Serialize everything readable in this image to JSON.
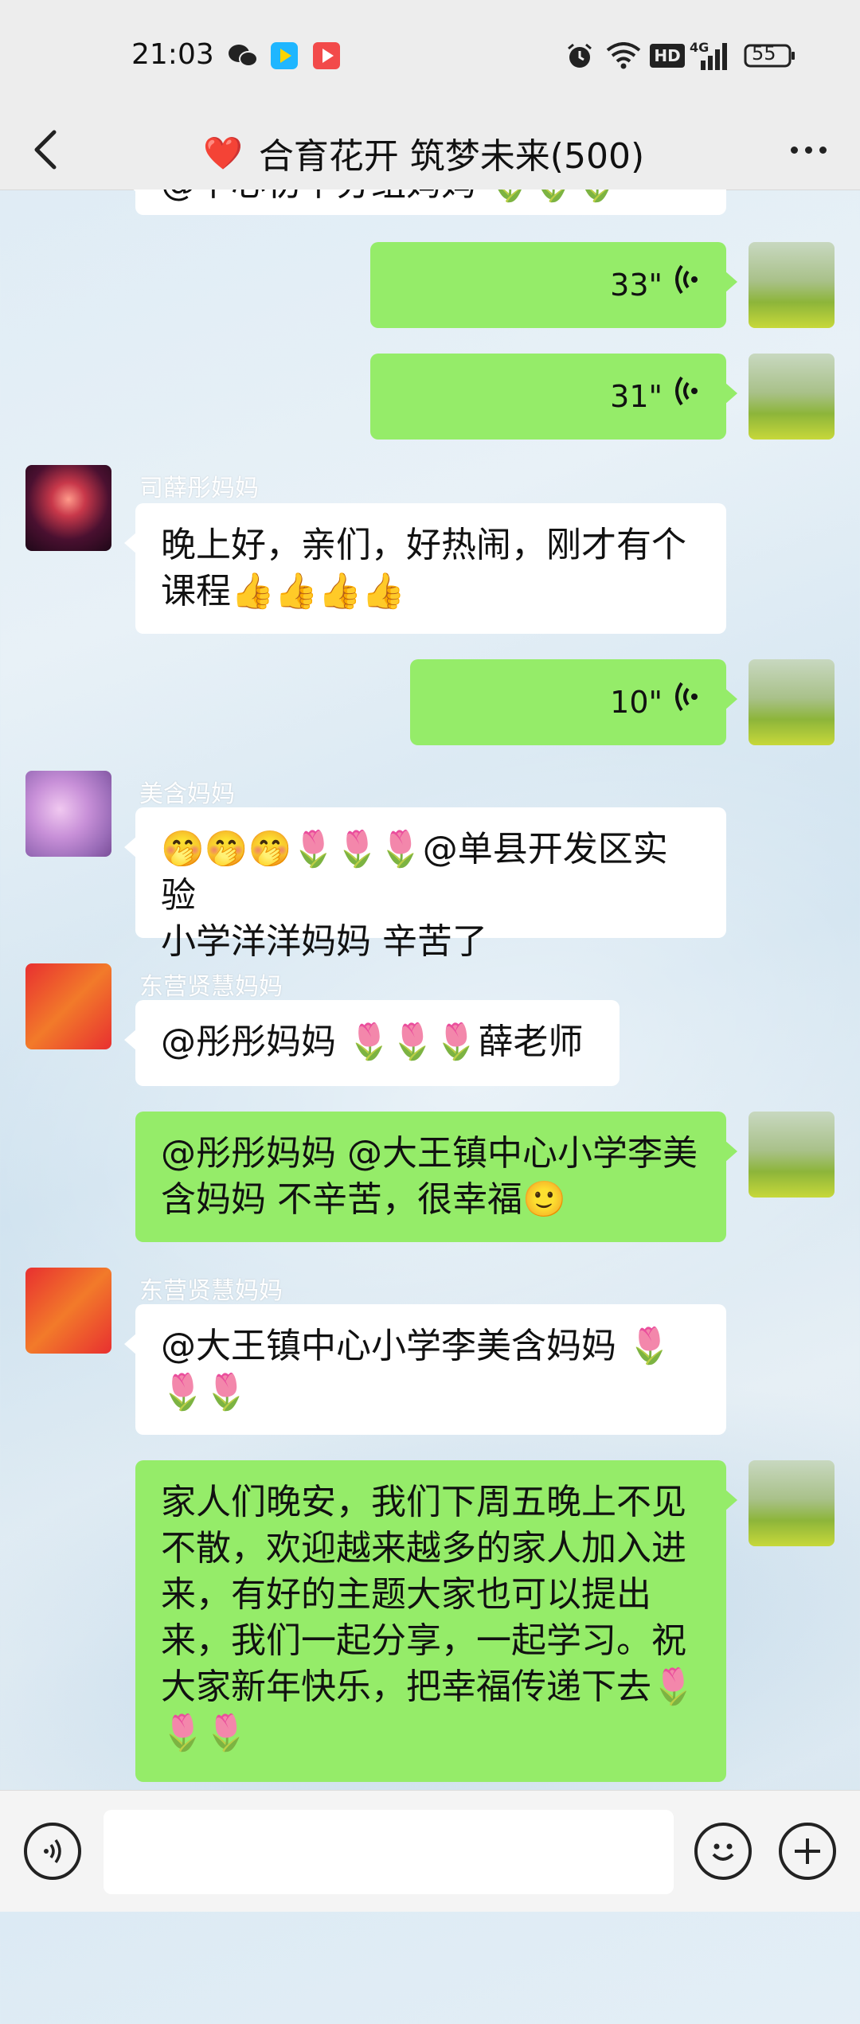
{
  "status_bar": {
    "time": "21:03",
    "battery": "55",
    "network": "4G",
    "hd": "HD",
    "icons": [
      "wechat-icon",
      "tencent-video-icon",
      "video-app-icon",
      "alarm-icon",
      "wifi-icon",
      "signal-icon",
      "battery-icon"
    ]
  },
  "header": {
    "title": "合育花开 筑梦未来(500)",
    "heart": "❤️"
  },
  "messages": [
    {
      "side": "in",
      "partial_text": "@中心初中分组妈妈 🌷🌷🌷"
    },
    {
      "side": "out",
      "type": "voice",
      "duration": "33\""
    },
    {
      "side": "out",
      "type": "voice",
      "duration": "31\""
    },
    {
      "side": "in",
      "sender": "司薛彤妈妈",
      "text_line1": "晚上好，亲们，好热闹，刚才有个",
      "text_line2": "课程👍👍👍👍"
    },
    {
      "side": "out",
      "type": "voice",
      "duration": "10\""
    },
    {
      "side": "in",
      "sender": "美含妈妈",
      "text_line1": "🤭🤭🤭🌷🌷🌷@单县开发区实验",
      "text_line2": "小学洋洋妈妈  辛苦了"
    },
    {
      "side": "in",
      "sender": "东营贤慧妈妈",
      "text_line1": "@彤彤妈妈  🌷🌷🌷薛老师"
    },
    {
      "side": "out",
      "text_line1": "@彤彤妈妈  @大王镇中心小学李美",
      "text_line2": "含妈妈  不辛苦，很幸福🙂"
    },
    {
      "side": "in",
      "sender": "东营贤慧妈妈",
      "text_line1": "@大王镇中心小学李美含妈妈  🌷",
      "text_line2": "🌷🌷"
    },
    {
      "side": "out",
      "text_lines": [
        "家人们晚安，我们下周五晚上不见",
        "不散，欢迎越来越多的家人加入进",
        "来，有好的主题大家也可以提出",
        "来，我们一起分享，一起学习。祝",
        "大家新年快乐，把幸福传递下去🌷",
        "🌷🌷"
      ]
    }
  ],
  "input_bar": {
    "placeholder": ""
  }
}
